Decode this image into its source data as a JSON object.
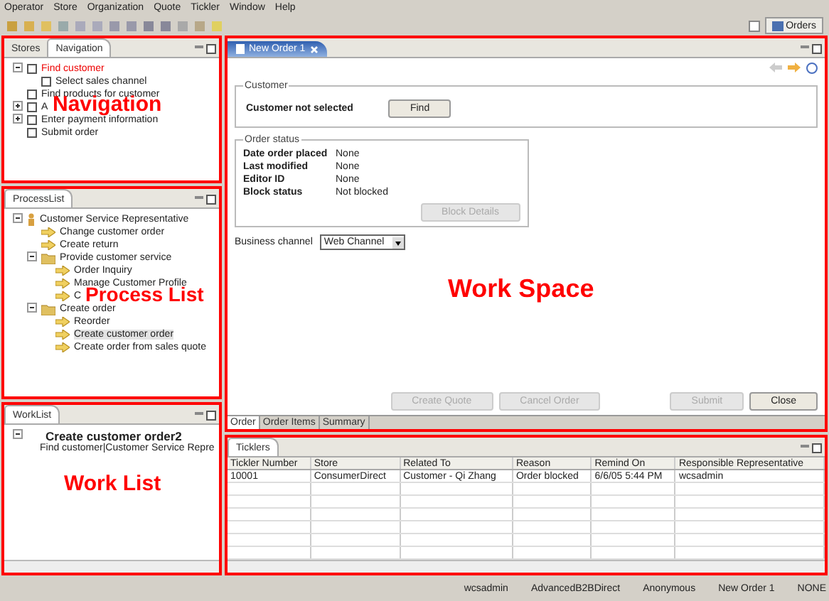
{
  "menu": [
    "Operator",
    "Store",
    "Organization",
    "Quote",
    "Tickler",
    "Window",
    "Help"
  ],
  "perspective": {
    "label": "Orders"
  },
  "navigation": {
    "annotation": "Navigation",
    "tabs": [
      {
        "label": "Stores",
        "selected": false
      },
      {
        "label": "Navigation",
        "selected": true
      }
    ],
    "items": [
      {
        "label": "Find customer",
        "current": true,
        "expanded": true,
        "children": [
          {
            "label": "Select sales channel",
            "current": false
          }
        ]
      },
      {
        "label": "Find products for customer",
        "current": false
      },
      {
        "label": "A",
        "current": false,
        "expanded": false
      },
      {
        "label": "Enter payment information",
        "current": false,
        "expanded": false
      },
      {
        "label": "Submit order",
        "current": false
      }
    ]
  },
  "process_list": {
    "title": "ProcessList",
    "annotation": "Process List",
    "items": [
      {
        "label": "Customer Service Representative",
        "kind": "role",
        "selected": false,
        "expanded": true,
        "children": [
          {
            "label": "Change customer order",
            "kind": "process",
            "selected": false
          },
          {
            "label": "Create return",
            "kind": "process",
            "selected": false
          },
          {
            "label": "Provide customer service",
            "kind": "folder",
            "selected": false,
            "expanded": true,
            "children": [
              {
                "label": "Order Inquiry",
                "kind": "process",
                "selected": false
              },
              {
                "label": "Manage Customer Profile",
                "kind": "process",
                "selected": false
              },
              {
                "label": "C",
                "kind": "process",
                "selected": false
              }
            ]
          },
          {
            "label": "Create order",
            "kind": "folder",
            "selected": false,
            "expanded": true,
            "children": [
              {
                "label": "Reorder",
                "kind": "process",
                "selected": false
              },
              {
                "label": "Create customer order",
                "kind": "process",
                "selected": true
              },
              {
                "label": "Create order from sales quote",
                "kind": "process",
                "selected": false
              }
            ]
          }
        ]
      }
    ]
  },
  "work_list": {
    "title": "WorkList",
    "annotation": "Work List",
    "items": [
      {
        "label": "Create customer order2",
        "expanded": true,
        "children": [
          {
            "label": "Find customer|Customer Service Repre"
          }
        ]
      }
    ]
  },
  "editor": {
    "tab": "New Order 1",
    "annotation": "Work Space",
    "customer": {
      "legend": "Customer",
      "status": "Customer not selected",
      "button": "Find"
    },
    "order_status": {
      "legend": "Order status",
      "rows": [
        {
          "label": "Date order placed",
          "value": "None"
        },
        {
          "label": "Last modified",
          "value": "None"
        },
        {
          "label": "Editor ID",
          "value": "None"
        },
        {
          "label": "Block status",
          "value": "Not blocked"
        }
      ],
      "button": {
        "label": "Block Details",
        "disabled": true
      }
    },
    "business_channel": {
      "label": "Business channel",
      "value": "Web Channel"
    },
    "actions": [
      {
        "label": "Create Quote",
        "disabled": true
      },
      {
        "label": "Cancel Order",
        "disabled": true
      },
      {
        "label": "Submit",
        "disabled": true
      },
      {
        "label": "Close",
        "disabled": false
      }
    ],
    "page_tabs": [
      {
        "label": "Order",
        "selected": true
      },
      {
        "label": "Order Items",
        "selected": false
      },
      {
        "label": "Summary",
        "selected": false
      }
    ]
  },
  "ticklers": {
    "title": "Ticklers",
    "columns": [
      "Tickler Number",
      "Store",
      "Related To",
      "Reason",
      "Remind On",
      "Responsible Representative"
    ],
    "rows": [
      [
        "10001",
        "ConsumerDirect",
        "Customer - Qi Zhang",
        "Order blocked",
        "6/6/05 5:44 PM",
        "wcsadmin"
      ]
    ]
  },
  "status_bar": [
    "wcsadmin",
    "AdvancedB2BDirect",
    "Anonymous",
    "New Order 1",
    "NONE"
  ]
}
